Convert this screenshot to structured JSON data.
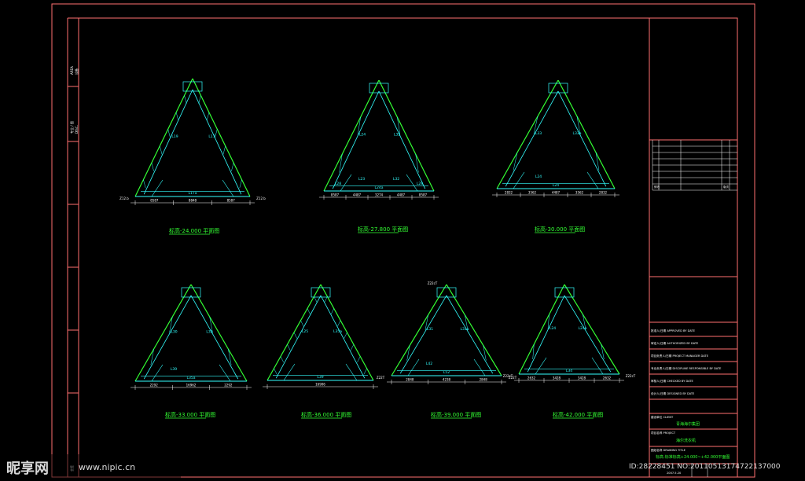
{
  "colors": {
    "frame": "#ff6f6f",
    "member": "#33ffff",
    "edge": "#33ff33",
    "caption": "#33ff33",
    "dimension": "#ffffff",
    "background": "#000000"
  },
  "side_strip": [
    "AREA",
    "设备",
    "专业 / 图",
    "DISC.",
    "会签"
  ],
  "plans": [
    {
      "caption": "标高-24.000 平面图",
      "dims": [
        "8587",
        "8848",
        "8587"
      ],
      "members": [
        "L19",
        "L17",
        "L17a"
      ],
      "nodes": [
        "Z12.b",
        "Z12.b"
      ]
    },
    {
      "caption": "标高-27.800 平面图",
      "dims": [
        "8587",
        "4487",
        "3274",
        "4487",
        "8587"
      ],
      "members": [
        "L24",
        "L35",
        "L24a",
        "L23",
        "L32",
        "L28",
        "L28"
      ]
    },
    {
      "caption": "标高-30.000 平面图",
      "dims": [
        "2832",
        "3562",
        "4487",
        "3562",
        "2832"
      ],
      "members": [
        "L33",
        "L33a",
        "L24",
        "L24"
      ]
    },
    {
      "caption": "标高-33.000 平面图",
      "dims": [
        "2292",
        "16962",
        "2292"
      ],
      "members": [
        "L30",
        "L35",
        "L35a",
        "L39"
      ]
    },
    {
      "caption": "标高-36.000 平面图",
      "dims": [
        "16906"
      ],
      "members": [
        "L25",
        "L35a",
        "L39"
      ]
    },
    {
      "caption": "标高-39.000 平面图",
      "dims": [
        "2848",
        "4238",
        "2848"
      ],
      "members": [
        "L31",
        "L31a",
        "L52",
        "L42"
      ],
      "nodes": [
        "Z22T",
        "Z22T",
        "Z22cT"
      ]
    },
    {
      "caption": "标高-42.000 平面图",
      "dims": [
        "2632",
        "3428",
        "3428",
        "2632"
      ],
      "members": [
        "L24",
        "L24a",
        "L34"
      ],
      "nodes": [
        "Z22cT",
        "Z22cT"
      ]
    }
  ],
  "title_block": {
    "row_labels": [
      "修改",
      "版次"
    ],
    "lines": [
      "批准人/日期 APPROVED BY DATE",
      "审定人/日期 AUTHORIZED BY DATE",
      "项目负责人/日期 PROJECT MANAGER DATE",
      "专业负责人/日期 DISCIPLINE RESPONSIBLE BY DATE",
      "审核人/日期 CHECKED BY DATE",
      "设计人/日期 DESIGNED BY DATE"
    ],
    "client_label": "建设单位 CLIENT",
    "client": "青海海尔集团",
    "project_label": "项目名称 PROJECT",
    "project": "海尔洗衣机",
    "drawing_label": "图纸名称 DRAWING TITLE",
    "drawing_title": "标高-标准标高+24.000~+42.000平面图",
    "bottom_left": "2007.5.20"
  },
  "watermark": {
    "logo": "昵享网",
    "url": "www.nipic.cn",
    "id": "ID:28228451 NO:20110513174722137000"
  }
}
